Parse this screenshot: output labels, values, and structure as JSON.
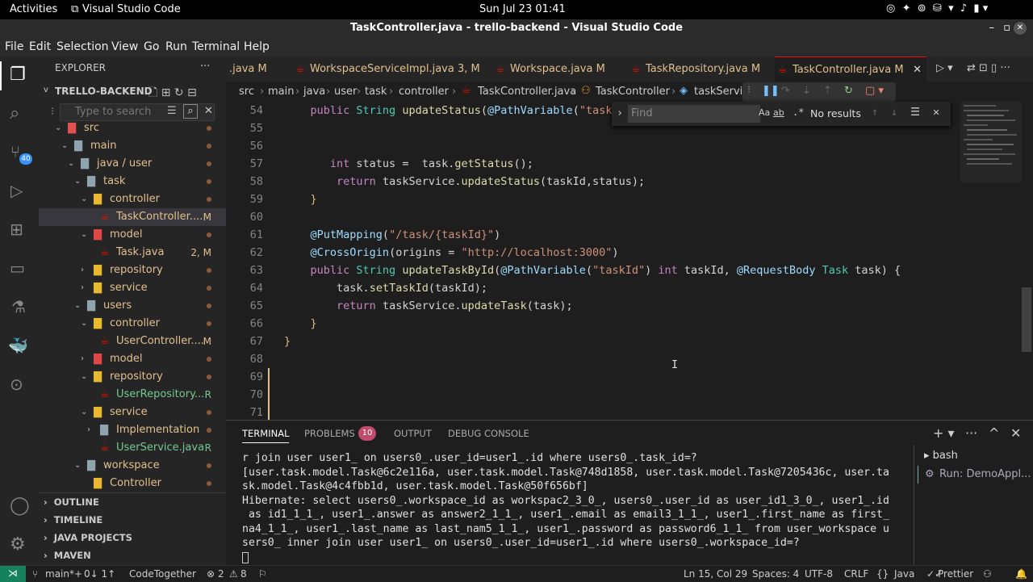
{
  "gnome": {
    "activities": "Activities",
    "app": "Visual Studio Code",
    "clock": "Sun Jul 23  01:41"
  },
  "window_title": "TaskController.java - trello-backend - Visual Studio Code",
  "menu": [
    "File",
    "Edit",
    "Selection",
    "View",
    "Go",
    "Run",
    "Terminal",
    "Help"
  ],
  "activity_badge": "40",
  "explorer": {
    "header": "EXPLORER",
    "project": "TRELLO-BACKEND",
    "search_placeholder": "Type to search",
    "items": [
      {
        "label": "src",
        "indent": 0,
        "type": "folder",
        "chev": "v"
      },
      {
        "label": "main",
        "indent": 1,
        "type": "folder",
        "chev": "v"
      },
      {
        "label": "java / user",
        "indent": 2,
        "type": "folder",
        "chev": "v"
      },
      {
        "label": "task",
        "indent": 3,
        "type": "folder",
        "chev": "v"
      },
      {
        "label": "controller",
        "indent": 4,
        "type": "folder",
        "chev": "v"
      },
      {
        "label": "TaskController....",
        "indent": 5,
        "type": "java",
        "badge": "M",
        "badgeColor": "#e2c08d",
        "selected": true
      },
      {
        "label": "model",
        "indent": 4,
        "type": "folder-red",
        "chev": "v"
      },
      {
        "label": "Task.java",
        "indent": 5,
        "type": "java",
        "badge": "2, M",
        "badgeColor": "#e2c08d"
      },
      {
        "label": "repository",
        "indent": 4,
        "type": "folder",
        "chev": ">"
      },
      {
        "label": "service",
        "indent": 4,
        "type": "folder",
        "chev": ">"
      },
      {
        "label": "users",
        "indent": 3,
        "type": "folder",
        "chev": "v"
      },
      {
        "label": "controller",
        "indent": 4,
        "type": "folder",
        "chev": "v"
      },
      {
        "label": "UserController....",
        "indent": 5,
        "type": "java",
        "badge": "M",
        "badgeColor": "#e2c08d"
      },
      {
        "label": "model",
        "indent": 4,
        "type": "folder-red",
        "chev": ">"
      },
      {
        "label": "repository",
        "indent": 4,
        "type": "folder",
        "chev": "v"
      },
      {
        "label": "UserRepository....",
        "indent": 5,
        "type": "java",
        "badge": "R",
        "badgeColor": "#73c991"
      },
      {
        "label": "service",
        "indent": 4,
        "type": "folder",
        "chev": "v"
      },
      {
        "label": "Implementation",
        "indent": 5,
        "type": "folder",
        "chev": ">"
      },
      {
        "label": "UserService.java",
        "indent": 5,
        "type": "java",
        "badge": "R",
        "badgeColor": "#73c991"
      },
      {
        "label": "workspace",
        "indent": 3,
        "type": "folder",
        "chev": "v"
      },
      {
        "label": "Controller",
        "indent": 4,
        "type": "folder",
        "chev": ""
      }
    ],
    "sections": [
      "OUTLINE",
      "TIMELINE",
      "JAVA PROJECTS",
      "MAVEN"
    ]
  },
  "tabs": [
    {
      "label": ".java",
      "mod": "M",
      "partial": true
    },
    {
      "label": "WorkspaceServiceImpl.java",
      "mod": "3, M"
    },
    {
      "label": "Workspace.java",
      "mod": "M"
    },
    {
      "label": "TaskRepository.java",
      "mod": "M"
    },
    {
      "label": "TaskController.java",
      "mod": "M",
      "active": true
    }
  ],
  "breadcrumb": [
    "src",
    "main",
    "java",
    "user",
    "task",
    "controller",
    "TaskController.java",
    "TaskController",
    "taskServi"
  ],
  "find": {
    "placeholder": "Find",
    "result": "No results",
    "opt1": "Aa",
    "opt2": "ab",
    "opt3": ".*"
  },
  "code_lines": [
    {
      "n": "54",
      "tokens": [
        [
          "    ",
          "pl"
        ],
        [
          "public ",
          "kw"
        ],
        [
          "String ",
          "ty"
        ],
        [
          "updateStatus",
          "fn"
        ],
        [
          "(",
          "pl"
        ],
        [
          "@PathVariable",
          "an"
        ],
        [
          "(",
          "pl"
        ],
        [
          "\"taskI",
          "str"
        ]
      ]
    },
    {
      "n": "55",
      "tokens": []
    },
    {
      "n": "56",
      "tokens": []
    },
    {
      "n": "57",
      "tokens": [
        [
          "       ",
          "pl"
        ],
        [
          "int ",
          "kw"
        ],
        [
          "status",
          "pl"
        ],
        [
          " =  ",
          "pl"
        ],
        [
          "task",
          "pl"
        ],
        [
          ".",
          "pl"
        ],
        [
          "getStatus",
          "fn"
        ],
        [
          "();",
          "pl"
        ]
      ]
    },
    {
      "n": "58",
      "tokens": [
        [
          "        ",
          "pl"
        ],
        [
          "return ",
          "kw"
        ],
        [
          "taskService",
          "pl"
        ],
        [
          ".",
          "pl"
        ],
        [
          "updateStatus",
          "fn"
        ],
        [
          "(taskId,status);",
          "pl"
        ]
      ]
    },
    {
      "n": "59",
      "tokens": [
        [
          "    ",
          "pl"
        ],
        [
          "}",
          "br"
        ]
      ]
    },
    {
      "n": "60",
      "tokens": []
    },
    {
      "n": "61",
      "tokens": [
        [
          "    ",
          "pl"
        ],
        [
          "@PutMapping",
          "an"
        ],
        [
          "(",
          "pl"
        ],
        [
          "\"/task/{taskId}\"",
          "str"
        ],
        [
          ")",
          "pl"
        ]
      ]
    },
    {
      "n": "62",
      "tokens": [
        [
          "    ",
          "pl"
        ],
        [
          "@CrossOrigin",
          "an"
        ],
        [
          "(origins = ",
          "pl"
        ],
        [
          "\"http://localhost:3000\"",
          "str"
        ],
        [
          ")",
          "pl"
        ]
      ]
    },
    {
      "n": "63",
      "tokens": [
        [
          "    ",
          "pl"
        ],
        [
          "public ",
          "kw"
        ],
        [
          "String ",
          "ty"
        ],
        [
          "updateTaskById",
          "fn"
        ],
        [
          "(",
          "pl"
        ],
        [
          "@PathVariable",
          "an"
        ],
        [
          "(",
          "pl"
        ],
        [
          "\"taskId\"",
          "str"
        ],
        [
          ") ",
          "pl"
        ],
        [
          "int ",
          "kw"
        ],
        [
          "taskId, ",
          "pl"
        ],
        [
          "@RequestBody ",
          "an"
        ],
        [
          "Task ",
          "ty"
        ],
        [
          "task) {",
          "pl"
        ]
      ]
    },
    {
      "n": "64",
      "tokens": [
        [
          "        ",
          "pl"
        ],
        [
          "task",
          "pl"
        ],
        [
          ".",
          "pl"
        ],
        [
          "setTaskId",
          "fn"
        ],
        [
          "(taskId);",
          "pl"
        ]
      ]
    },
    {
      "n": "65",
      "tokens": [
        [
          "        ",
          "pl"
        ],
        [
          "return ",
          "kw"
        ],
        [
          "taskService",
          "pl"
        ],
        [
          ".",
          "pl"
        ],
        [
          "updateTask",
          "fn"
        ],
        [
          "(task);",
          "pl"
        ]
      ]
    },
    {
      "n": "66",
      "tokens": [
        [
          "    ",
          "pl"
        ],
        [
          "}",
          "br"
        ]
      ]
    },
    {
      "n": "67",
      "tokens": [
        [
          "}",
          "br"
        ]
      ]
    },
    {
      "n": "68",
      "tokens": []
    },
    {
      "n": "69",
      "tokens": []
    },
    {
      "n": "70",
      "tokens": []
    },
    {
      "n": "71",
      "tokens": []
    }
  ],
  "panel": {
    "tabs": [
      "TERMINAL",
      "PROBLEMS",
      "OUTPUT",
      "DEBUG CONSOLE"
    ],
    "problems_count": "10",
    "terminals": [
      "bash",
      "Run: DemoAppl..."
    ],
    "output": [
      "r join user user1_ on users0_.user_id=user1_.id where users0_.task_id=?",
      "[user.task.model.Task@6c2e116a, user.task.model.Task@748d1858, user.task.model.Task@7205436c, user.ta",
      "sk.model.Task@4c4fbb1d, user.task.model.Task@50f656bf]",
      "Hibernate: select users0_.workspace_id as workspac2_3_0_, users0_.user_id as user_id1_3_0_, user1_.id",
      " as id1_1_1_, user1_.answer as answer2_1_1_, user1_.email as email3_1_1_, user1_.first_name as first_",
      "na4_1_1_, user1_.last_name as last_nam5_1_1_, user1_.password as password6_1_1_ from user_workspace u",
      "sers0_ inner join user user1_ on users0_.user_id=user1_.id where users0_.workspace_id=?",
      ""
    ]
  },
  "status": {
    "branch": "main*+",
    "sync": "0↓ 1↑",
    "codetogether": "CodeTogether",
    "errors": "2",
    "warnings": "8",
    "position": "Ln 15, Col 29",
    "spaces": "Spaces: 4",
    "encoding": "UTF-8",
    "eol": "CRLF",
    "lang": "Java",
    "prettier": "Prettier"
  }
}
